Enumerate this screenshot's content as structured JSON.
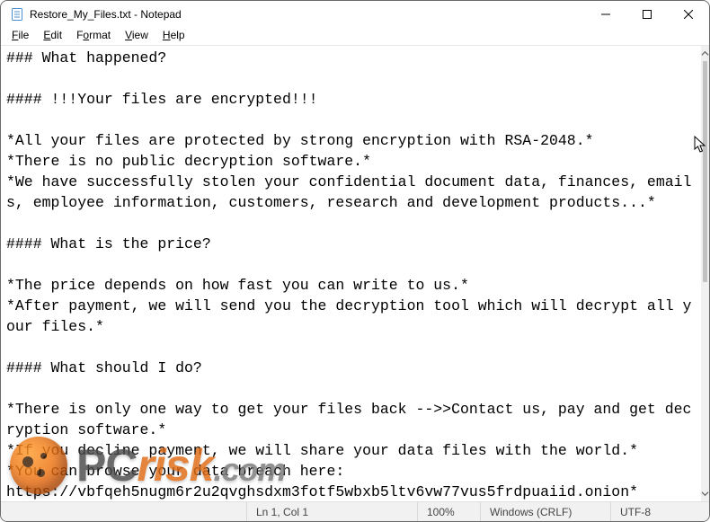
{
  "window": {
    "title": "Restore_My_Files.txt - Notepad"
  },
  "menu": {
    "file": "File",
    "edit": "Edit",
    "format": "Format",
    "view": "View",
    "help": "Help"
  },
  "content": "### What happened?\n\n#### !!!Your files are encrypted!!!\n\n*All your files are protected by strong encryption with RSA-2048.*\n*There is no public decryption software.*\n*We have successfully stolen your confidential document data, finances, emails, employee information, customers, research and development products...*\n\n#### What is the price?\n\n*The price depends on how fast you can write to us.*\n*After payment, we will send you the decryption tool which will decrypt all your files.*\n\n#### What should I do?\n\n*There is only one way to get your files back -->>Contact us, pay and get decryption software.*\n*If you decline payment, we will share your data files with the world.*\n*You can browse your data breach here:\nhttps://vbfqeh5nugm6r2u2qvghsdxm3fotf5wbxb5ltv6vw77vus5frdpuaiid.onion*\n(You should download and install TOR browser first hxxps://torproject.org)",
  "status": {
    "lncol": "Ln 1, Col 1",
    "zoom": "100%",
    "line_ending": "Windows (CRLF)",
    "encoding": "UTF-8"
  },
  "watermark": {
    "p1": "PC",
    "p2": "risk",
    "p3": ".com"
  }
}
